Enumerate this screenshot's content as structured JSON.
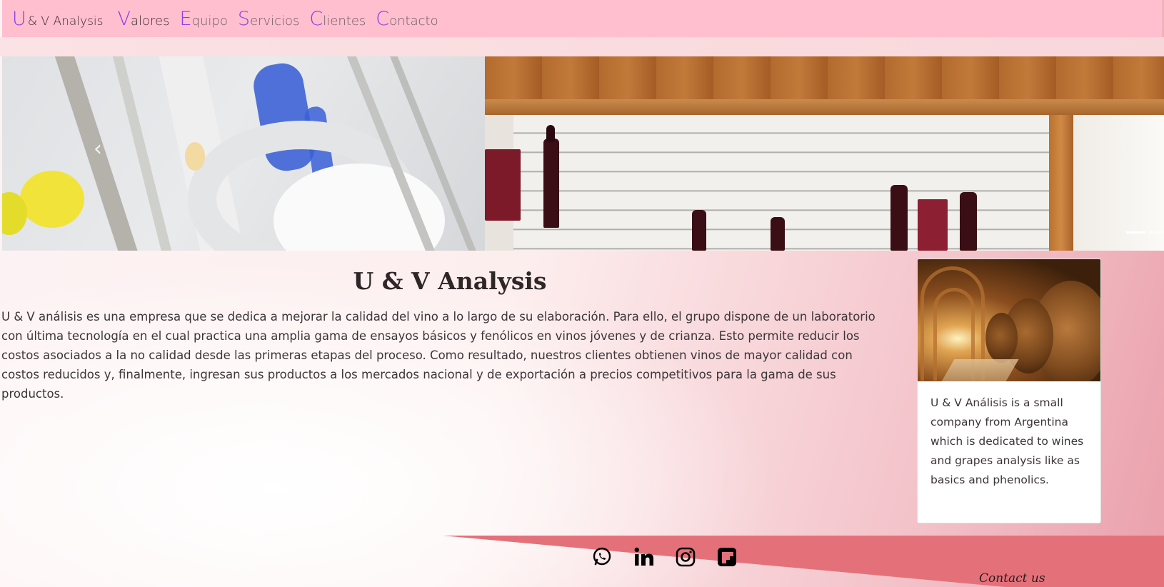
{
  "nav": {
    "brand_cap": "U",
    "brand_rest": "& V Analysis",
    "links": [
      {
        "cap": "V",
        "rest": "alores"
      },
      {
        "cap": "E",
        "rest": "quipo"
      },
      {
        "cap": "S",
        "rest": "ervicios"
      },
      {
        "cap": "C",
        "rest": "lientes"
      },
      {
        "cap": "C",
        "rest": "ontacto"
      }
    ]
  },
  "carousel": {
    "prev_glyph": "‹",
    "slide_count": 3,
    "active_index": 0
  },
  "main": {
    "title": "U & V Analysis",
    "text": "U & V análisis es una empresa que se dedica a mejorar la calidad del vino a lo largo de su elaboración. Para ello, el grupo dispone de un laboratorio con última tecnología en el cual practica una amplia gama de ensayos básicos y fenólicos en vinos jóvenes y de crianza. Esto permite reducir los costos asociados a la no calidad desde las primeras etapas del proceso. Como resultado, nuestros clientes obtienen vinos de mayor calidad con costos reducidos y, finalmente, ingresan sus productos a los mercados nacional y de exportación a precios competitivos para la gama de sus productos."
  },
  "card": {
    "text": "U & V Análisis is a small company from Argentina which is dedicated to wines and grapes analysis like as basics and phenolics."
  },
  "footer": {
    "social_icons": [
      "whatsapp-icon",
      "linkedin-icon",
      "instagram-icon",
      "flipboard-icon"
    ],
    "contact_label": "Contact us"
  },
  "colors": {
    "navbar_bg": "#ffbfce",
    "nav_accent": "#8b3ee8",
    "footer_band": "#e4717a"
  }
}
